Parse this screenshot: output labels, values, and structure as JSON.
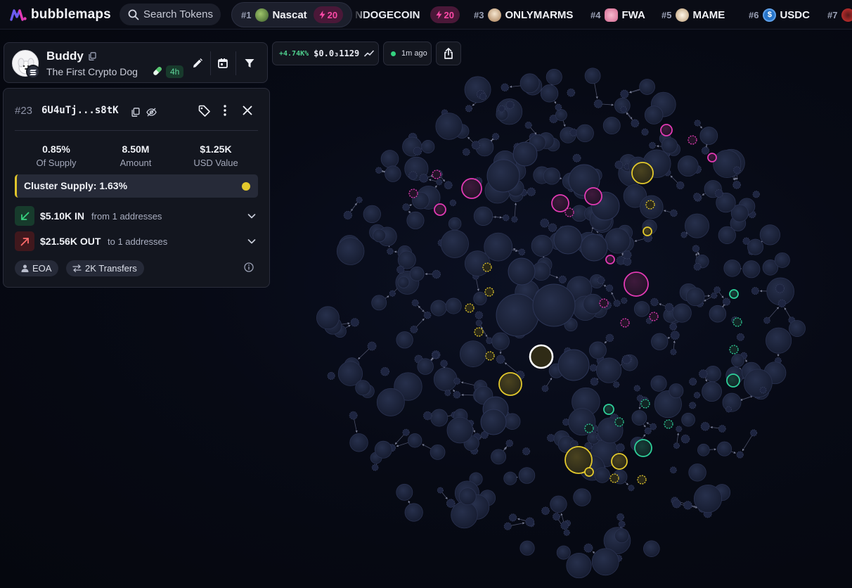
{
  "app": {
    "name": "bubblemaps"
  },
  "search": {
    "label": "Search Tokens"
  },
  "ticker": [
    {
      "rank": "#1",
      "name": "Nascat",
      "boost": "20",
      "icon_color": "#4c7a3a"
    },
    {
      "rank": "",
      "name": "NDOGECOIN",
      "boost": "20",
      "icon_color": ""
    },
    {
      "rank": "#3",
      "name": "ONLYMARMS",
      "boost": "",
      "icon_color": "#d9c7a6"
    },
    {
      "rank": "#4",
      "name": "FWA",
      "boost": "",
      "icon_color": "#f2a3c0"
    },
    {
      "rank": "#5",
      "name": "MAME",
      "boost": "",
      "icon_color": "#f0e2cf"
    },
    {
      "rank": "#6",
      "name": "USDC",
      "boost": "",
      "icon_color": "#2775ca"
    },
    {
      "rank": "#7",
      "name": "",
      "boost": "",
      "icon_color": "#d33"
    }
  ],
  "token": {
    "name": "Buddy",
    "description": "The First Crypto Dog",
    "age": "4h"
  },
  "price": {
    "change": "+4.74K%",
    "value": "$0.0₃1129"
  },
  "updated": {
    "label": "1m ago"
  },
  "address": {
    "rank": "#23",
    "short": "6U4uTj...s8tK",
    "stats": [
      {
        "value": "0.85%",
        "label": "Of Supply"
      },
      {
        "value": "8.50M",
        "label": "Amount"
      },
      {
        "value": "$1.25K",
        "label": "USD Value"
      }
    ],
    "cluster": {
      "label": "Cluster Supply: 1.63%",
      "color": "#e3c92c"
    },
    "inflow": {
      "amount": "$5.10K IN",
      "detail": "from 1 addresses"
    },
    "outflow": {
      "amount": "$21.56K OUT",
      "detail": "to 1 addresses"
    },
    "tags": [
      "EOA",
      "2K Transfers"
    ]
  },
  "colors": {
    "bubble": "#1a2137",
    "cluster_yellow": "#e3c92c",
    "cluster_magenta": "#e23ab4",
    "cluster_green": "#2ed09a",
    "accent_pink": "#ff4aa8"
  }
}
